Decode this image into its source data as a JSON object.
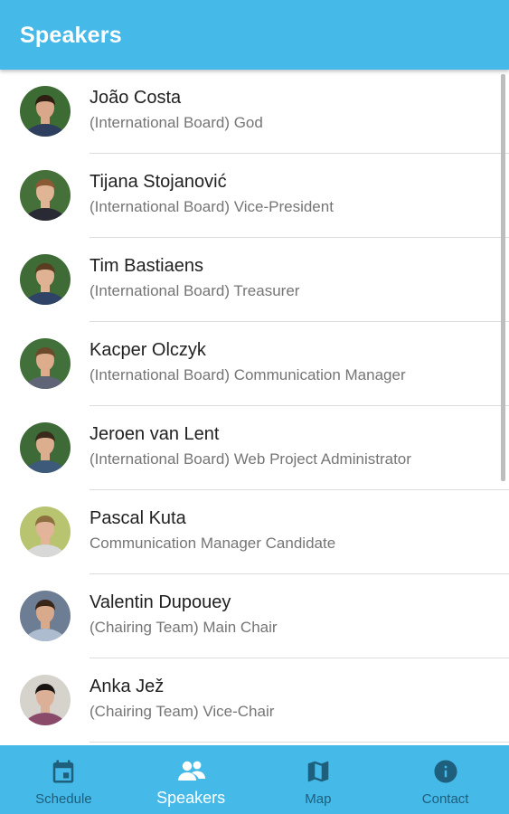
{
  "app_bar": {
    "title": "Speakers"
  },
  "speakers": [
    {
      "name": "João Costa",
      "role": "(International Board) God",
      "skin": "#d9a88a",
      "hair": "#2e1e14",
      "bg": "#3d6b34",
      "shirt": "#2d3e5e"
    },
    {
      "name": "Tijana Stojanović",
      "role": "(International Board) Vice-President",
      "skin": "#e0b596",
      "hair": "#8a5a34",
      "bg": "#46703a",
      "shirt": "#2a2a35"
    },
    {
      "name": "Tim Bastiaens",
      "role": "(International Board) Treasurer",
      "skin": "#e0b294",
      "hair": "#5a3c22",
      "bg": "#3f6c36",
      "shirt": "#2e4366"
    },
    {
      "name": "Kacper Olczyk",
      "role": "(International Board) Communication Manager",
      "skin": "#dcac8c",
      "hair": "#6b4a2c",
      "bg": "#42703a",
      "shirt": "#5f6576"
    },
    {
      "name": "Jeroen van Lent",
      "role": "(International Board) Web Project Administrator",
      "skin": "#dcae90",
      "hair": "#3a2a1c",
      "bg": "#3e6a37",
      "shirt": "#3e5a7a"
    },
    {
      "name": "Pascal Kuta",
      "role": "Communication Manager Candidate",
      "skin": "#e2b59a",
      "hair": "#8c7040",
      "bg": "#b8c470",
      "shirt": "#d8d8d8"
    },
    {
      "name": "Valentin Dupouey",
      "role": "(Chairing Team) Main Chair",
      "skin": "#d8a98a",
      "hair": "#3a2618",
      "bg": "#6d7d94",
      "shirt": "#aebcd0"
    },
    {
      "name": "Anka Jež",
      "role": "(Chairing Team) Vice-Chair",
      "skin": "#dcb097",
      "hair": "#1a1412",
      "bg": "#d6d2cc",
      "shirt": "#8a4a6a"
    }
  ],
  "bottom_nav": [
    {
      "label": "Schedule",
      "icon": "calendar-icon",
      "active": false
    },
    {
      "label": "Speakers",
      "icon": "people-icon",
      "active": true
    },
    {
      "label": "Map",
      "icon": "map-icon",
      "active": false
    },
    {
      "label": "Contact",
      "icon": "info-icon",
      "active": false
    }
  ],
  "colors": {
    "primary": "#45b9e8",
    "nav_inactive": "#1d5f7c",
    "nav_active": "#ffffff"
  }
}
